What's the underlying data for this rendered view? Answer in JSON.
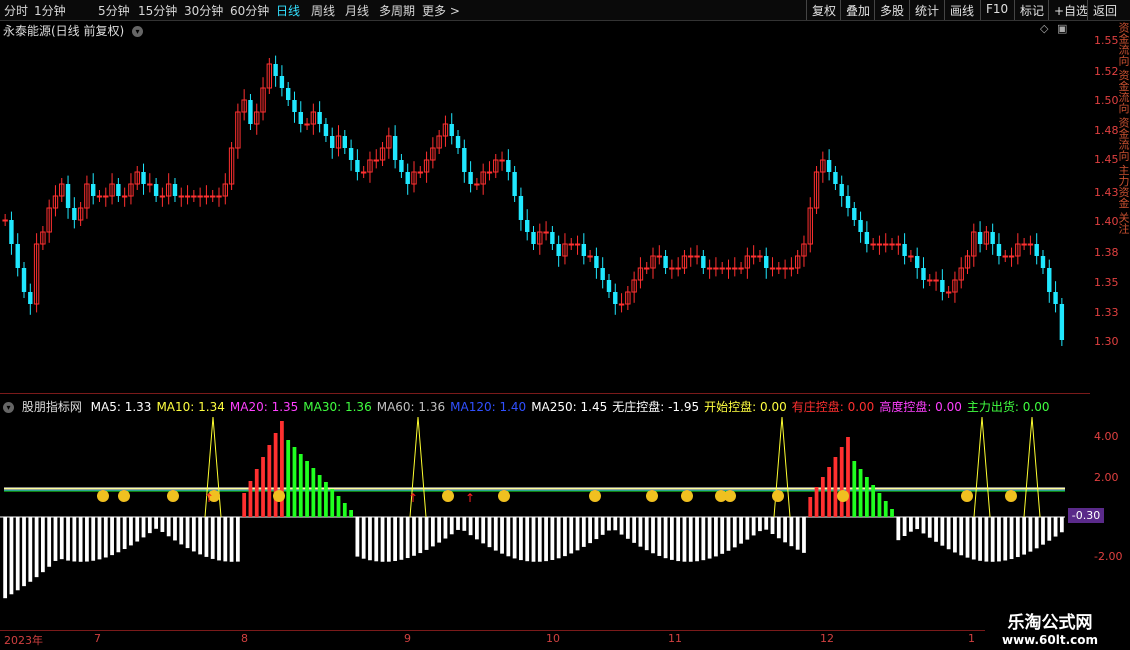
{
  "toolbar": {
    "left_items": [
      "分时",
      "1分钟",
      "5分钟",
      "15分钟",
      "30分钟",
      "60分钟",
      "日线",
      "周线",
      "月线",
      "多周期",
      "更多 >"
    ],
    "active": "日线",
    "right_items": [
      "复权",
      "叠加",
      "多股",
      "统计",
      "画线",
      "F10",
      "标记",
      "+自选",
      "返回"
    ]
  },
  "stock_title": "永泰能源(日线 前复权)",
  "price_axis": [
    "1.55",
    "1.52",
    "1.50",
    "1.48",
    "1.45",
    "1.43",
    "1.40",
    "1.38",
    "1.35",
    "1.33",
    "1.30"
  ],
  "indicator": {
    "name": "股朋指标网",
    "items": [
      {
        "text": "MA5: 1.33",
        "color": "#ffffff"
      },
      {
        "text": "MA10: 1.34",
        "color": "#ffff40"
      },
      {
        "text": "MA20: 1.35",
        "color": "#ff40ff"
      },
      {
        "text": "MA30: 1.36",
        "color": "#40ff40"
      },
      {
        "text": "MA60: 1.36",
        "color": "#c0c0c0"
      },
      {
        "text": "MA120: 1.40",
        "color": "#3050ff"
      },
      {
        "text": "MA250: 1.45",
        "color": "#ffffff"
      },
      {
        "text": "无庄控盘: -1.95",
        "color": "#ffffff"
      },
      {
        "text": "开始控盘: 0.00",
        "color": "#ffff40"
      },
      {
        "text": "有庄控盘: 0.00",
        "color": "#ff3030"
      },
      {
        "text": "高度控盘: 0.00",
        "color": "#ff40ff"
      },
      {
        "text": "主力出货: 0.00",
        "color": "#40ff40"
      }
    ]
  },
  "indicator_axis": [
    "4.00",
    "2.00",
    "-2.00"
  ],
  "current_value_badge": "-0.30",
  "date_axis": [
    "2023年",
    "7",
    "8",
    "9",
    "10",
    "11",
    "12",
    "1"
  ],
  "side_strip_text": "资金流向 资金流向 资金流向 主力资金 关注",
  "watermark": {
    "line1": "乐淘公式网",
    "line2": "www.60lt.com"
  },
  "colors": {
    "up": "#ff3030",
    "down": "#20e8ff",
    "green": "#20ff20",
    "white": "#ffffff",
    "yellow": "#ffff30"
  }
}
